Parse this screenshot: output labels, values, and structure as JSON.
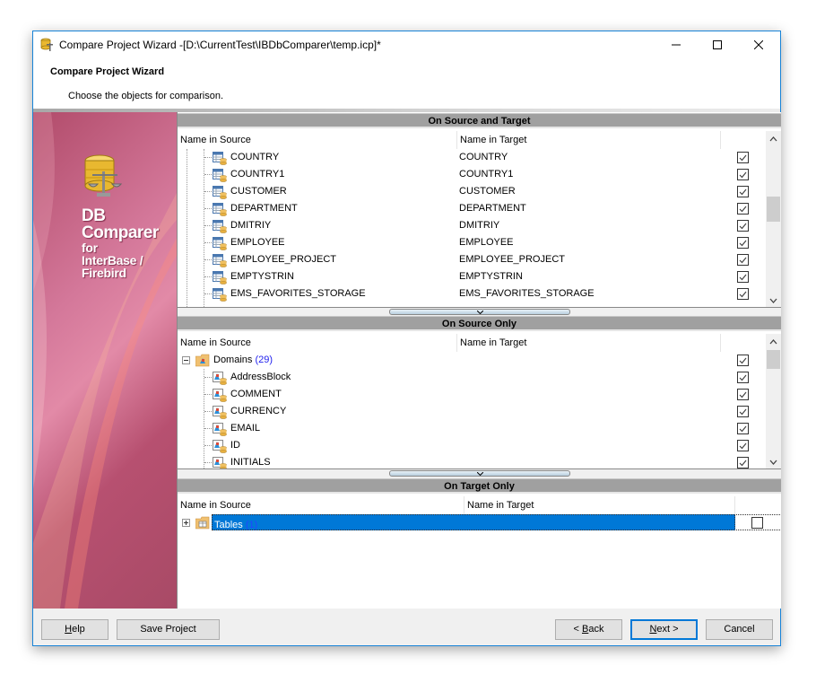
{
  "window": {
    "title": "Compare Project Wizard -[D:\\CurrentTest\\IBDbComparer\\temp.icp]*",
    "app_icon": "db-comparer-app-icon",
    "controls": [
      "minimize",
      "maximize",
      "close"
    ]
  },
  "header": {
    "title": "Compare Project Wizard",
    "subtitle": "Choose the objects for comparison."
  },
  "sidebar": {
    "logo_line1": "DB",
    "logo_line2": "Comparer",
    "logo_line3": "for",
    "logo_line4": "InterBase /",
    "logo_line5": "Firebird",
    "accent_color": "#b14b6a"
  },
  "sections": {
    "both": {
      "title": "On Source and Target",
      "col_source": "Name in Source",
      "col_target": "Name in Target",
      "rows": [
        {
          "source": "COUNTRY",
          "target": "COUNTRY",
          "checked": true
        },
        {
          "source": "COUNTRY1",
          "target": "COUNTRY1",
          "checked": true
        },
        {
          "source": "CUSTOMER",
          "target": "CUSTOMER",
          "checked": true
        },
        {
          "source": "DEPARTMENT",
          "target": "DEPARTMENT",
          "checked": true
        },
        {
          "source": "DMITRIY",
          "target": "DMITRIY",
          "checked": true
        },
        {
          "source": "EMPLOYEE",
          "target": "EMPLOYEE",
          "checked": true
        },
        {
          "source": "EMPLOYEE_PROJECT",
          "target": "EMPLOYEE_PROJECT",
          "checked": true
        },
        {
          "source": "EMPTYSTRIN",
          "target": "EMPTYSTRIN",
          "checked": true
        },
        {
          "source": "EMS_FAVORITES_STORAGE",
          "target": "EMS_FAVORITES_STORAGE",
          "checked": true
        }
      ]
    },
    "source_only": {
      "title": "On Source Only",
      "col_source": "Name in Source",
      "col_target": "Name in Target",
      "group": {
        "label": "Domains",
        "count": "(29)",
        "expanded": true,
        "checked": true
      },
      "rows": [
        {
          "source": "AddressBlock",
          "checked": true
        },
        {
          "source": "COMMENT",
          "checked": true
        },
        {
          "source": "CURRENCY",
          "checked": true
        },
        {
          "source": "EMAIL",
          "checked": true
        },
        {
          "source": "ID",
          "checked": true
        },
        {
          "source": "INITIALS",
          "checked": true
        }
      ]
    },
    "target_only": {
      "title": "On Target Only",
      "col_source": "Name in Source",
      "col_target": "Name in Target",
      "group": {
        "label": "Tables",
        "count": "(1)",
        "expanded": false,
        "checked": false,
        "selected": true
      }
    }
  },
  "footer": {
    "help": "Help",
    "save_project": "Save Project",
    "back": "< Back",
    "next": "Next >",
    "cancel": "Cancel"
  }
}
